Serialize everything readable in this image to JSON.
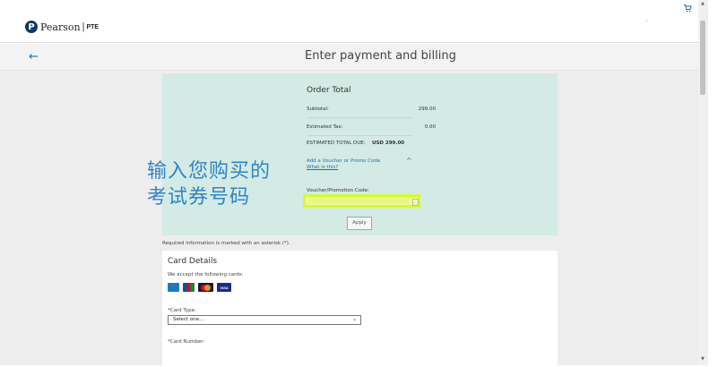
{
  "header": {
    "logo_mark": "P",
    "logo_text": "Pearson",
    "logo_divider": "|",
    "logo_sub": "PTE",
    "cart_icon": "cart-icon"
  },
  "page": {
    "back_icon": "back-arrow-icon",
    "title": "Enter payment and billing"
  },
  "order": {
    "title": "Order Total",
    "subtotal_label": "Subtotal:",
    "subtotal_value": "299.00",
    "tax_label": "Estimated Tax:",
    "tax_value": "0.00",
    "total_label": "ESTIMATED TOTAL DUE:",
    "total_value": "USD 299.00",
    "promo_link": "Add a Voucher or Promo Code",
    "whatis_link": "What is this?",
    "voucher_label": "Voucher/Promotion Code:",
    "voucher_value": "",
    "apply_label": "Apply"
  },
  "annotation": {
    "line1": "输入您购买的",
    "line2": "考试券号码"
  },
  "required_note": "Required information is marked with an asterisk (*).",
  "card": {
    "title": "Card Details",
    "accept_text": "We accept the following cards:",
    "logos": [
      "amex-logo",
      "jcb-logo",
      "mastercard-logo",
      "visa-logo"
    ],
    "visa_text": "VISA",
    "card_type_label": "*Card Type:",
    "card_type_value": "Select one...",
    "card_number_label": "*Card Number:"
  }
}
